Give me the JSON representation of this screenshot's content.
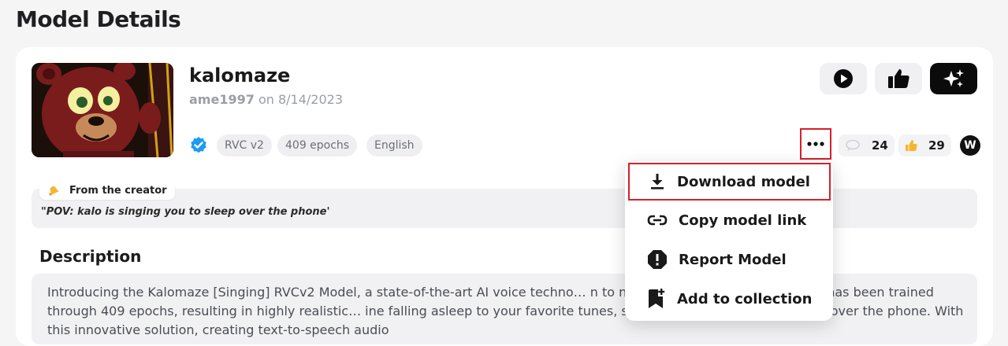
{
  "page": {
    "title": "Model Details"
  },
  "model": {
    "name": "kalomaze",
    "author": "ame1997",
    "date_text": "on 8/14/2023",
    "tags": [
      "RVC v2",
      "409 epochs",
      "English"
    ],
    "comments": "24",
    "likes": "29",
    "avatar_letter": "W"
  },
  "creator": {
    "label": "From the creator",
    "quote": "\"POV: kalo is singing you to sleep over the phone'"
  },
  "description": {
    "title": "Description",
    "text": "Introducing the Kalomaze [Singing] RVCv2 Model, a state-of-the-art AI voice techno… n to new heights. This advanced tool has been trained through 409 epochs, resulting in highly realistic… ine falling asleep to your favorite tunes, sung by a virtual Kalomaze right over the phone. With this innovative solution, creating text-to-speech audio"
  },
  "menu": {
    "items": [
      {
        "label": "Download model",
        "icon": "download-icon"
      },
      {
        "label": "Copy model link",
        "icon": "link-icon"
      },
      {
        "label": "Report Model",
        "icon": "report-icon"
      },
      {
        "label": "Add to collection",
        "icon": "bookmark-add-icon"
      }
    ]
  },
  "colors": {
    "highlight": "#d6202a",
    "verified": "#1d9bf0",
    "dark_button": "#0b0b0c"
  }
}
